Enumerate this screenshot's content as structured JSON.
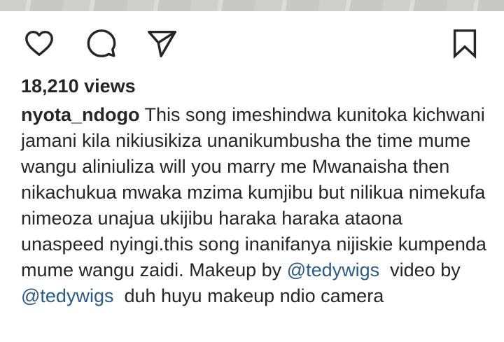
{
  "post": {
    "views_label": "18,210 views",
    "username": "nyota_ndogo",
    "caption_parts": [
      "This song imeshindwa kunitoka kichwani jamani kila nikiusikiza unanikumbusha the time mume wangu aliniuliza will you marry me Mwanaisha then nikachukua mwaka mzima kumjibu but nilikua nimekufa nimeoza unajua ukijibu haraka haraka ataona unaspeed nyingi.this song inanifanya nijiskie kumpenda mume wangu zaidi. Makeup by ",
      "@tedywigs",
      "  video by ",
      "@tedywigs",
      "  duh huyu makeup ndio camera"
    ]
  },
  "icons": {
    "like": "heart-icon",
    "comment": "comment-bubble-icon",
    "share": "paper-plane-icon",
    "save": "bookmark-icon"
  },
  "colors": {
    "text": "#262626",
    "mention": "#2a5a87"
  }
}
